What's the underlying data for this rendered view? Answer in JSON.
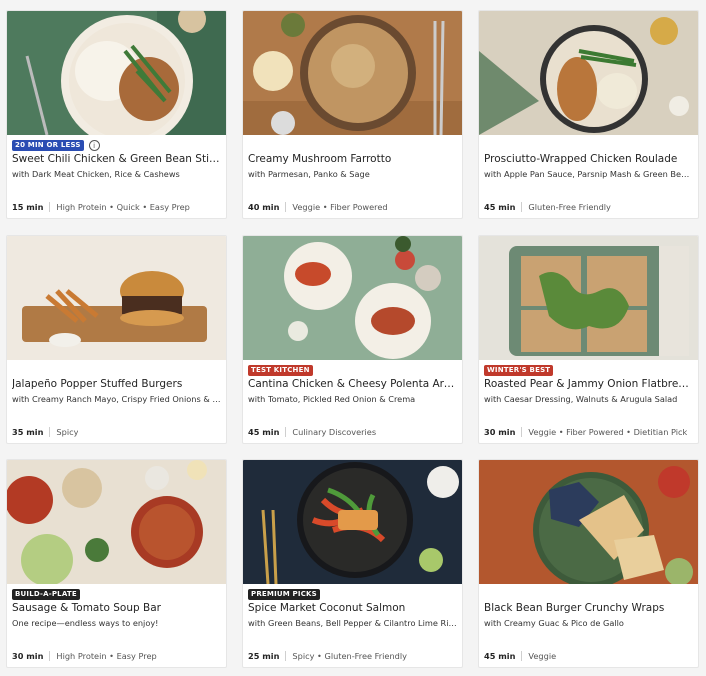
{
  "colors": {
    "badge_blue": "#2a4db3",
    "badge_red": "#c0392b",
    "badge_dark": "#222222"
  },
  "recipes": [
    {
      "badge": "20 MIN OR LESS",
      "badge_color": "#2a4db3",
      "title": "Sweet Chili Chicken & Green Bean Stir-Fry",
      "subtitle": "with Dark Meat Chicken, Rice & Cashews",
      "time": "15 min",
      "tags": "High Protein • Quick • Easy Prep"
    },
    {
      "badge": "",
      "title": "Creamy Mushroom Farrotto",
      "subtitle": "with Parmesan, Panko & Sage",
      "time": "40 min",
      "tags": "Veggie • Fiber Powered"
    },
    {
      "badge": "",
      "title": "Prosciutto-Wrapped Chicken Roulade",
      "subtitle": "with Apple Pan Sauce, Parsnip Mash & Green Beans",
      "time": "45 min",
      "tags": "Gluten-Free Friendly"
    },
    {
      "badge": "",
      "title": "Jalapeño Popper Stuffed Burgers",
      "subtitle": "with Creamy Ranch Mayo, Crispy Fried Onions & Potato Wedges",
      "time": "35 min",
      "tags": "Spicy"
    },
    {
      "badge": "TEST KITCHEN",
      "badge_color": "#c0392b",
      "title": "Cantina Chicken & Cheesy Polenta Arepas",
      "subtitle": "with Tomato, Pickled Red Onion & Crema",
      "time": "45 min",
      "tags": "Culinary Discoveries"
    },
    {
      "badge": "WINTER'S BEST",
      "badge_color": "#c0392b",
      "title": "Roasted Pear & Jammy Onion Flatbreads",
      "subtitle": "with Caesar Dressing, Walnuts & Arugula Salad",
      "time": "30 min",
      "tags": "Veggie • Fiber Powered • Dietitian Pick"
    },
    {
      "badge": "BUILD-A-PLATE",
      "badge_color": "#222222",
      "title": "Sausage & Tomato Soup Bar",
      "subtitle": "One recipe—endless ways to enjoy!",
      "time": "30 min",
      "tags": "High Protein • Easy Prep"
    },
    {
      "badge": "PREMIUM PICKS",
      "badge_color": "#222222",
      "title": "Spice Market Coconut Salmon",
      "subtitle": "with Green Beans, Bell Pepper & Cilantro Lime Rice",
      "time": "25 min",
      "tags": "Spicy • Gluten-Free Friendly"
    },
    {
      "badge": "",
      "title": "Black Bean Burger Crunchy Wraps",
      "subtitle": "with Creamy Guac & Pico de Gallo",
      "time": "45 min",
      "tags": "Veggie"
    }
  ]
}
